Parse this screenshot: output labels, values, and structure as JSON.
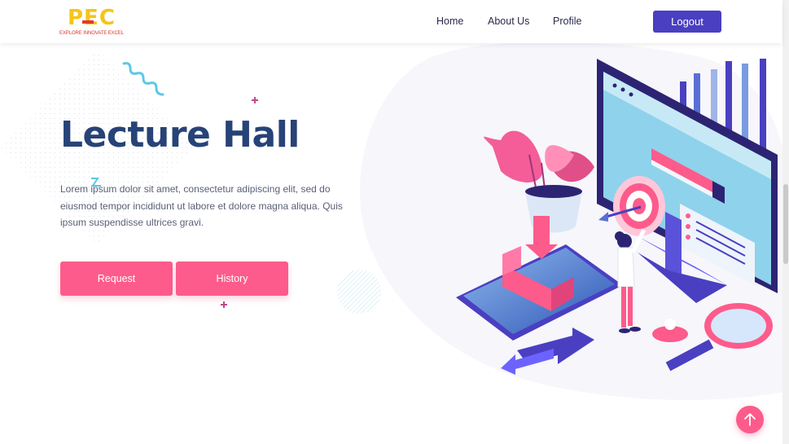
{
  "brand": {
    "logo_text": "PEC",
    "tagline": "EXPLORE INNOVATE EXCEL"
  },
  "nav": {
    "items": [
      {
        "label": "Home"
      },
      {
        "label": "About Us"
      },
      {
        "label": "Profile"
      }
    ],
    "logout_label": "Logout"
  },
  "hero": {
    "title": "Lecture Hall",
    "description": "Lorem ipsum dolor sit amet, consectetur adipiscing elit, sed do eiusmod tempor incididunt ut labore et dolore magna aliqua. Quis ipsum suspendisse ultrices gravi.",
    "buttons": [
      {
        "label": "Request"
      },
      {
        "label": "History"
      }
    ]
  },
  "icons": {
    "back_to_top": "arrow-up-icon"
  },
  "colors": {
    "primary": "#4a3fc1",
    "accent": "#fd5b8b",
    "title": "#274377"
  }
}
